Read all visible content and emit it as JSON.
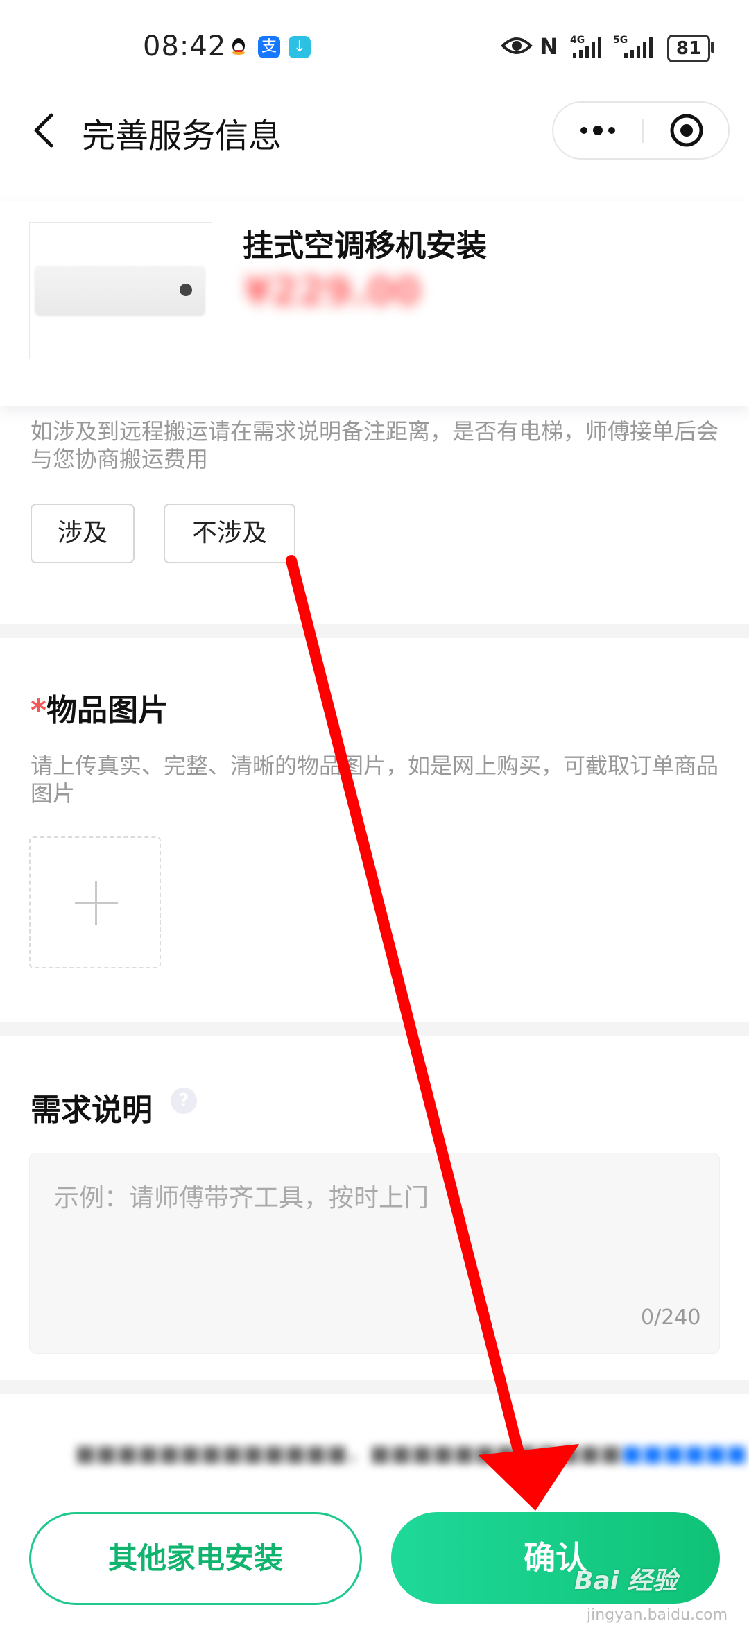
{
  "status_bar": {
    "time": "08:42",
    "battery": "81"
  },
  "header": {
    "title": "完善服务信息"
  },
  "product": {
    "name": "挂式空调移机安装",
    "price": "¥229.00"
  },
  "carry": {
    "hint": "如涉及到远程搬运请在需求说明备注距离，是否有电梯，师傅接单后会与您协商搬运费用",
    "options": [
      "涉及",
      "不涉及"
    ]
  },
  "photo": {
    "required_mark": "*",
    "title": "物品图片",
    "hint": "请上传真实、完整、清晰的物品图片，如是网上购买，可截取订单商品图片"
  },
  "requirement": {
    "title": "需求说明",
    "help": "?",
    "placeholder": "示例：请师傅带齐工具，按时上门",
    "count": "0/240"
  },
  "bottom": {
    "other_label": "其他家电安装",
    "confirm_label": "确认"
  },
  "colors": {
    "accent": "#10c27a",
    "price": "#ff6b6b",
    "annotation": "#ff0000"
  },
  "watermark": {
    "brand": "Bai 经验",
    "url": "jingyan.baidu.com"
  }
}
